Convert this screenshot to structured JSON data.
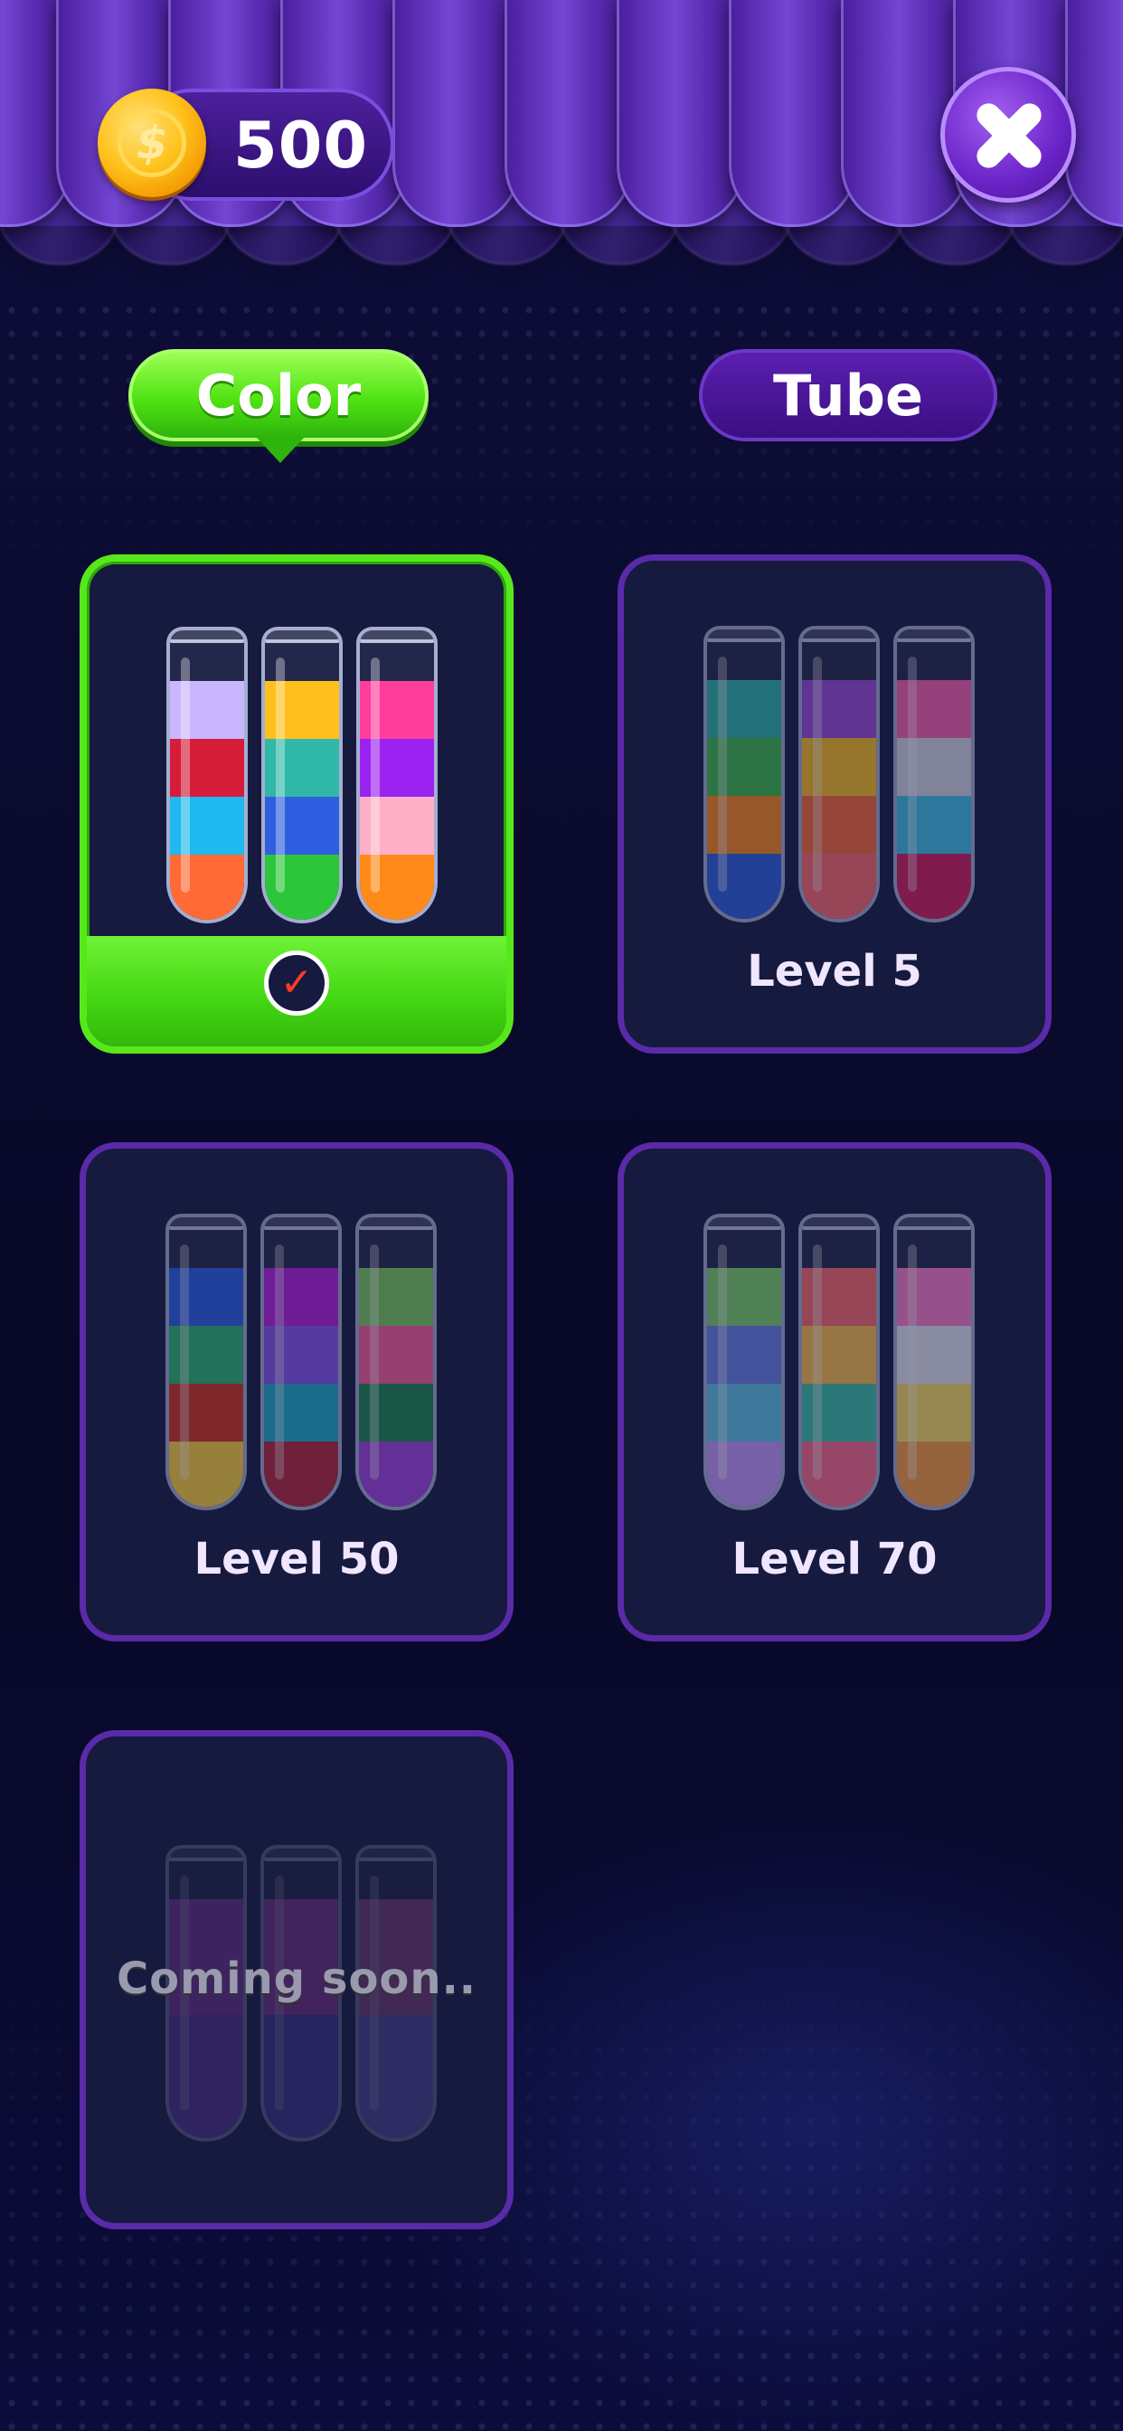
{
  "header": {
    "coins": "500",
    "coin_icon": "gold-coin-icon",
    "close_icon": "close-x-icon"
  },
  "tabs": [
    {
      "label": "Color",
      "active": true
    },
    {
      "label": "Tube",
      "active": false
    }
  ],
  "colors": {
    "accent_green": "#4fe313",
    "accent_purple": "#5a2aa8",
    "background": "#070824"
  },
  "cards": [
    {
      "label": "",
      "state": "selected",
      "check_icon": "checkmark-icon",
      "tubes": [
        [
          "#c9b6ff",
          "#d51d3a",
          "#1fb8ef",
          "#ff6a35"
        ],
        [
          "#ffc01e",
          "#2fb8a8",
          "#2f5fe0",
          "#2bc63a"
        ],
        [
          "#ff3d9a",
          "#9b22f0",
          "#ffb0c8",
          "#ff8a1a"
        ]
      ]
    },
    {
      "label": "Level 5",
      "state": "locked",
      "tubes": [
        [
          "#2fb8a8",
          "#3fbf4a",
          "#ff8a1a",
          "#2f5fe0"
        ],
        [
          "#9b4ad8",
          "#ffc01e",
          "#ff6a35",
          "#ff6a6a"
        ],
        [
          "#ff5fb0",
          "#d9d9e8",
          "#3fc4e8",
          "#d81d5a"
        ]
      ]
    },
    {
      "label": "Level 50",
      "state": "locked",
      "tubes": [
        [
          "#2a5fe8",
          "#2fb870",
          "#d5341f",
          "#ffd53a"
        ],
        [
          "#b81fe0",
          "#8b55f0",
          "#1fb0c8",
          "#b8263a"
        ],
        [
          "#7fcf5a",
          "#ff5f9a",
          "#1f8a50",
          "#a042e0"
        ]
      ]
    },
    {
      "label": "Level 70",
      "state": "locked",
      "tubes": [
        [
          "#7fd46a",
          "#6a7fe8",
          "#5fc8e8",
          "#c89aff"
        ],
        [
          "#ff6a6a",
          "#ffc24a",
          "#3fc4a8",
          "#ff6a8a"
        ],
        [
          "#ff7fc8",
          "#e8e8f0",
          "#ffe060",
          "#ffa040"
        ]
      ]
    },
    {
      "label": "",
      "state": "coming-soon",
      "soon_text": "Coming soon..",
      "tubes": [
        [
          "#c84ad8",
          "#c84ad8",
          "#8a4ad8",
          "#8a4ad8"
        ],
        [
          "#d84ac8",
          "#d84ac8",
          "#6a4ad8",
          "#6a4ad8"
        ],
        [
          "#d85aa8",
          "#d85aa8",
          "#8a6ae8",
          "#8a6ae8"
        ]
      ]
    }
  ]
}
